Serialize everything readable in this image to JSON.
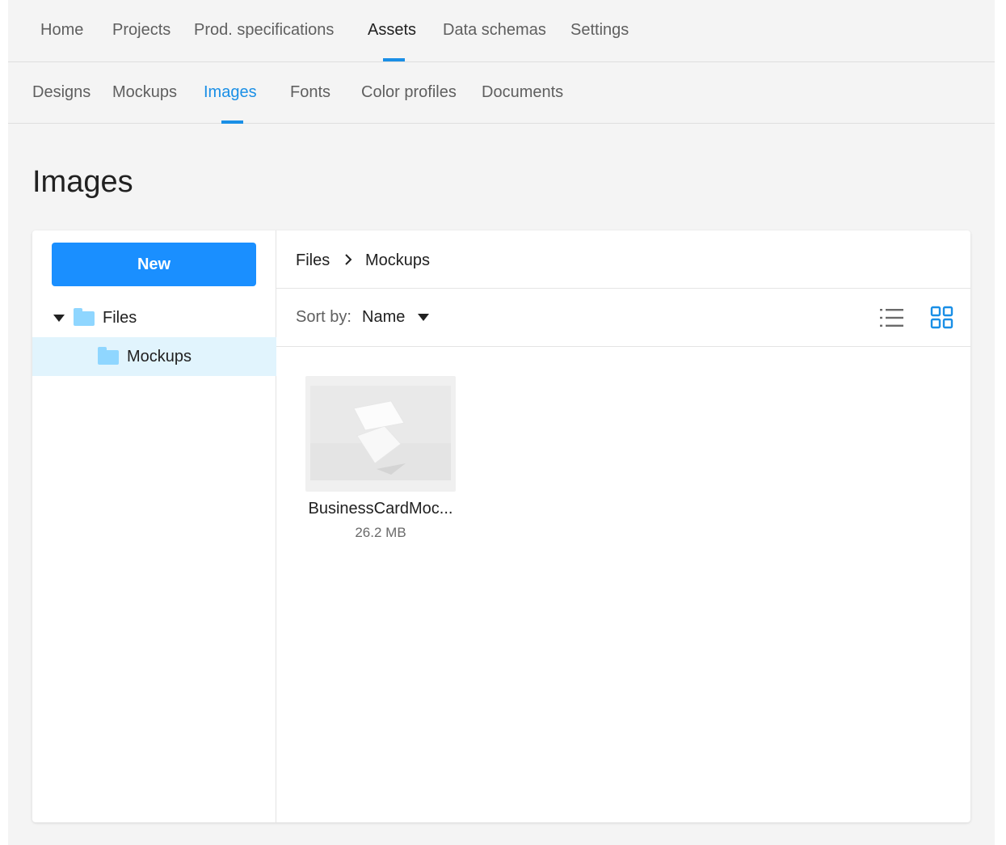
{
  "nav": {
    "primary": [
      "Home",
      "Projects",
      "Prod. specifications",
      "Assets",
      "Data schemas",
      "Settings"
    ],
    "primary_active": "Assets",
    "secondary": [
      "Designs",
      "Mockups",
      "Images",
      "Fonts",
      "Color profiles",
      "Documents"
    ],
    "secondary_active": "Images"
  },
  "page": {
    "title": "Images"
  },
  "sidebar": {
    "new_label": "New",
    "tree": [
      {
        "label": "Files",
        "expanded": true,
        "selected": false
      },
      {
        "label": "Mockups",
        "selected": true
      }
    ]
  },
  "breadcrumb": [
    "Files",
    "Mockups"
  ],
  "toolbar": {
    "sort_label": "Sort by:",
    "sort_value": "Name",
    "active_view": "grid"
  },
  "files": [
    {
      "name": "BusinessCardMoc...",
      "size": "26.2 MB"
    }
  ],
  "colors": {
    "accent": "#1a8fe6",
    "button": "#1a8fff",
    "folder": "#8fd6ff",
    "selected_row": "#e1f4fd"
  }
}
